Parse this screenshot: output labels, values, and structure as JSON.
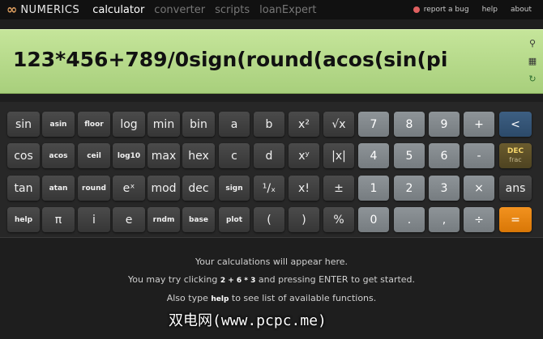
{
  "app": {
    "logo_mark": "∞",
    "logo_text": "NUMERICS"
  },
  "nav": {
    "tabs": [
      {
        "label": "calculator",
        "active": true
      },
      {
        "label": "converter",
        "active": false
      },
      {
        "label": "scripts",
        "active": false
      },
      {
        "label": "loanExpert",
        "active": false
      }
    ],
    "report_bug": "report a bug",
    "help": "help",
    "about": "about"
  },
  "display": {
    "expression": "123*456+789/0sign(round(acos(sin(pi",
    "icons": [
      "pin-icon",
      "keyboard-icon",
      "recycle-icon"
    ]
  },
  "keys": {
    "row1": [
      "sin",
      "asin",
      "floor",
      "log",
      "min",
      "bin",
      "a",
      "b",
      "x²",
      "√x",
      "7",
      "8",
      "9",
      "+",
      "<"
    ],
    "row2": [
      "cos",
      "acos",
      "ceil",
      "log10",
      "max",
      "hex",
      "c",
      "d",
      "xʸ",
      "|x|",
      "4",
      "5",
      "6",
      "-",
      "DEC"
    ],
    "row2_dec_sub": "frac",
    "row3": [
      "tan",
      "atan",
      "round",
      "eˣ",
      "mod",
      "dec",
      "sign",
      "¹/ₓ",
      "x!",
      "±",
      "1",
      "2",
      "3",
      "×",
      "ans"
    ],
    "row4": [
      "help",
      "π",
      "i",
      "e",
      "rndm",
      "base",
      "plot",
      "(",
      ")",
      "%",
      "0",
      ".",
      ",",
      "÷",
      "="
    ]
  },
  "messages": {
    "line1": "Your calculations will appear here.",
    "line2_pre": "You may try clicking",
    "line2_code": "2 + 6 * 3",
    "line2_post": "and pressing ENTER to get started.",
    "line3_pre": "Also type",
    "line3_code": "help",
    "line3_post": "to see list of available functions."
  },
  "watermark": "双电网(www.pcpc.me)",
  "colors": {
    "display_bg": "#b8dc8c",
    "accent_orange": "#f2921f",
    "accent_blue": "#34597a",
    "dec_gold": "#f5d56a"
  }
}
